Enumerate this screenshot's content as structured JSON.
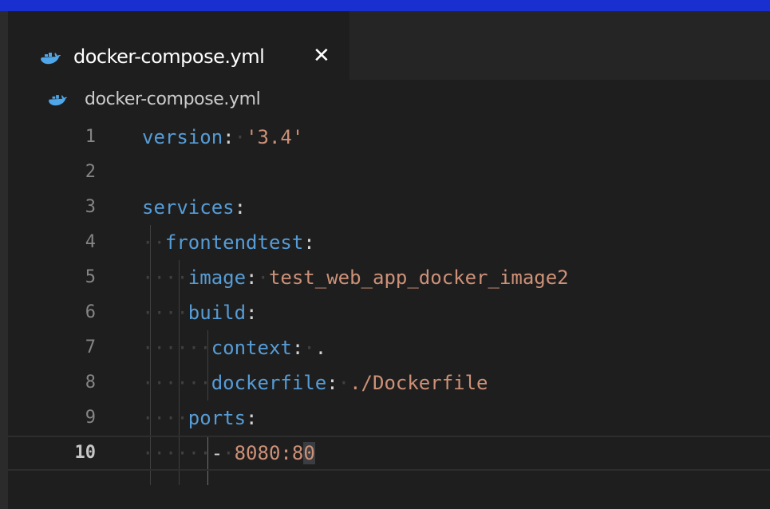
{
  "tab": {
    "title": "docker-compose.yml",
    "close": "✕",
    "icon": "docker-whale-icon"
  },
  "breadcrumb": {
    "label": "docker-compose.yml",
    "icon": "docker-whale-icon"
  },
  "editor": {
    "lines": [
      {
        "number": "1",
        "key": "version",
        "sep": ":",
        "value": "'3.4'"
      },
      {
        "number": "2"
      },
      {
        "number": "3",
        "key": "services",
        "sep": ":"
      },
      {
        "number": "4",
        "key": "frontendtest",
        "sep": ":"
      },
      {
        "number": "5",
        "key": "image",
        "sep": ":",
        "value": "test_web_app_docker_image2"
      },
      {
        "number": "6",
        "key": "build",
        "sep": ":"
      },
      {
        "number": "7",
        "key": "context",
        "sep": ":",
        "value": "."
      },
      {
        "number": "8",
        "key": "dockerfile",
        "sep": ":",
        "value": "./Dockerfile"
      },
      {
        "number": "9",
        "key": "ports",
        "sep": ":"
      },
      {
        "number": "10",
        "dash": "-",
        "value": "8080:80"
      }
    ],
    "current_line": "10"
  },
  "colors": {
    "accent_bar": "#1a2fd0",
    "key": "#569cd6",
    "string": "#ce9178",
    "background": "#1e1e1e"
  }
}
